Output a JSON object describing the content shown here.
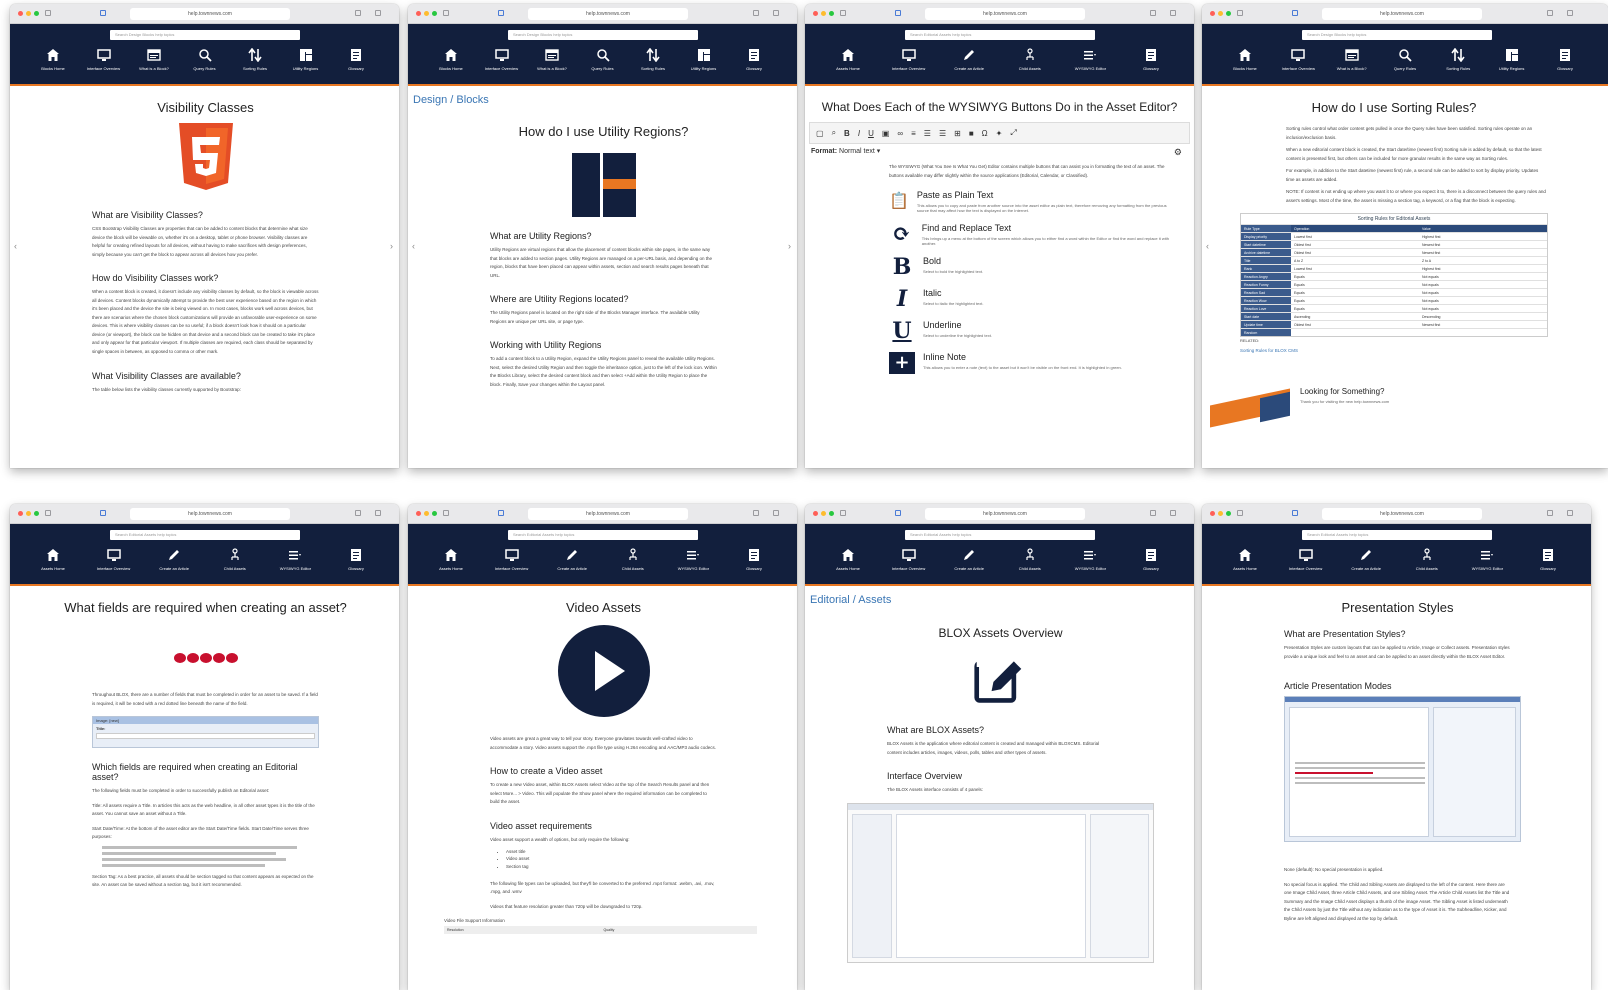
{
  "url": "help.townnews.com",
  "windows": [
    {
      "search": "Search Design Blocks help topics",
      "nav": [
        {
          "icon": "home-icon",
          "label": "Blocks Home"
        },
        {
          "icon": "monitor-icon",
          "label": "Interface Overview"
        },
        {
          "icon": "browser-icon",
          "label": "What is a Block?"
        },
        {
          "icon": "search-icon",
          "label": "Query Rules"
        },
        {
          "icon": "sort-icon",
          "label": "Sorting Rules"
        },
        {
          "icon": "layout-icon",
          "label": "Utility Regions"
        },
        {
          "icon": "book-icon",
          "label": "Glossary"
        }
      ],
      "title": "Visibility Classes",
      "sections": [
        {
          "heading": "What are Visibility Classes?",
          "body": "CSS Bootstrap Visibility Classes are properties that can be added to content blocks that determine what size device the block will be viewable on, whether it's on a desktop, tablet or phone browser. Visibility classes are helpful for creating refined layouts for all devices, without having to make sacrifices with design preferences, simply because you can't get the block to appear across all devices how you prefer."
        },
        {
          "heading": "How do Visibility Classes work?",
          "body": "When a content block is created, it doesn't include any visibility classes by default, so the block is viewable across all devices. Content blocks dynamically attempt to provide the best user experience based on the region in which it's been placed and the device the site is being viewed on. In most cases, blocks work well across devices, but there are scenarios where the chosen block customizations will provide an unfavorable user-experience on some devices. This is where visibility classes can be so useful; if a block doesn't look how it should on a particular device (or viewport), the block can be hidden on that device and a second block can be created to take it's place and only appear for that particular viewport. If multiple classes are required, each class should be separated by single spaces in between, as opposed to comma or other mark."
        },
        {
          "heading": "What Visibility Classes are available?",
          "body": "The table below lists the visibility classes currently supported by Bootstrap:"
        }
      ]
    },
    {
      "search": "Search Design Blocks help topics",
      "nav": [
        {
          "icon": "home-icon",
          "label": "Blocks Home"
        },
        {
          "icon": "monitor-icon",
          "label": "Interface Overview"
        },
        {
          "icon": "browser-icon",
          "label": "What is a Block?"
        },
        {
          "icon": "search-icon",
          "label": "Query Rules"
        },
        {
          "icon": "sort-icon",
          "label": "Sorting Rules"
        },
        {
          "icon": "layout-icon",
          "label": "Utility Regions"
        },
        {
          "icon": "book-icon",
          "label": "Glossary"
        }
      ],
      "breadcrumb": "Design / Blocks",
      "title": "How do I use Utility Regions?",
      "sections": [
        {
          "heading": "What are Utility Regions?",
          "body": "Utility Regions are virtual regions that allow the placement of content blocks within site pages, in the same way that blocks are added to section pages. Utility Regions are managed on a per-URL basis, and depending on the region, blocks that have been placed can appear within assets, section and search results pages beneath that URL."
        },
        {
          "heading": "Where are Utility Regions located?",
          "body": "The Utility Regions panel is located on the right side of the Blocks Manager interface. The available Utility Regions are unique per URL site, or page type."
        },
        {
          "heading": "Working with Utility Regions",
          "body": "To add a content block to a Utility Region, expand the Utility Regions panel to reveal the available Utility Regions. Next, select the desired Utility Region and then toggle the inheritance option, just to the left of the lock icon. Within the Blocks Library, select the desired content block and then select +Add within the Utility Region to place the block. Finally, Save your changes within the Layout panel."
        }
      ]
    },
    {
      "search": "Search Editorial Assets help topics",
      "nav": [
        {
          "icon": "home-icon",
          "label": "Assets Home"
        },
        {
          "icon": "monitor-icon",
          "label": "Interface Overview"
        },
        {
          "icon": "pencil-icon",
          "label": "Create an Article"
        },
        {
          "icon": "tree-icon",
          "label": "Child Assets"
        },
        {
          "icon": "list-icon",
          "label": "WYSIWYG Editor"
        },
        {
          "icon": "book-icon",
          "label": "Glossary"
        }
      ],
      "title": "What Does Each of the WYSIWYG Buttons Do in the Asset Editor?",
      "format_label": "Format:",
      "format_value": "Normal text",
      "intro": "The WYSIWYG (What You See Is What You Get) Editor contains multiple buttons that can assist you in formatting the text of an asset. The buttons available may differ slightly within the source applications (Editorial, Calendar, or Classified).",
      "buttons": [
        {
          "icon": "clipboard-icon",
          "glyph": "📋",
          "name": "Paste as Plain Text",
          "desc": "This allows you to copy and paste from another source into the asset editor as plain text, therefore removing any formatting from the previous source that may affect how the text is displayed on the Internet."
        },
        {
          "icon": "find-replace-icon",
          "glyph": "⟳",
          "name": "Find and Replace Text",
          "desc": "This brings up a menu at the bottom of the screen which allows you to either find a word within the Editor or find the word and replace it with another."
        },
        {
          "icon": "bold-icon",
          "glyph": "B",
          "name": "Bold",
          "desc": "Select to bold the highlighted text."
        },
        {
          "icon": "italic-icon",
          "glyph": "I",
          "name": "Italic",
          "desc": "Select to italic the highlighted text."
        },
        {
          "icon": "underline-icon",
          "glyph": "U",
          "name": "Underline",
          "desc": "Select to underline the highlighted text."
        },
        {
          "icon": "inline-note-icon",
          "glyph": "+",
          "name": "Inline Note",
          "desc": "This allows you to enter a note (text) to the asset but it won't be visible on the front end. It is highlighted in green."
        }
      ]
    },
    {
      "search": "Search Design Blocks help topics",
      "nav": [
        {
          "icon": "home-icon",
          "label": "Blocks Home"
        },
        {
          "icon": "monitor-icon",
          "label": "Interface Overview"
        },
        {
          "icon": "browser-icon",
          "label": "What is a Block?"
        },
        {
          "icon": "search-icon",
          "label": "Query Rules"
        },
        {
          "icon": "sort-icon",
          "label": "Sorting Rules"
        },
        {
          "icon": "layout-icon",
          "label": "Utility Regions"
        },
        {
          "icon": "book-icon",
          "label": "Glossary"
        }
      ],
      "title": "How do I use Sorting Rules?",
      "paragraphs": [
        "Sorting rules control what order content gets pulled in once the Query rules have been satisfied. Sorting rules operate on an inclusion/exclusion basis.",
        "When a new editorial content block is created, the Start date/time (newest first) Sorting rule is added by default, so that the latest content is presented first, but others can be included for more granular results in the same way as Sorting rules.",
        "For example, in addition to the Start datetime (newest first) rule, a second rule can be added to sort by display priority. Updates time as assets are added.",
        "NOTE: If content is not ending up where you want it to or where you expect it to, there is a disconnect between the query rules and asset's settings. Most of the time, the asset is missing a section tag, a keyword, or a flag that the block is expecting."
      ],
      "table": {
        "caption": "Sorting Rules for Editorial Assets",
        "headers": [
          "Rule Type",
          "Operation",
          "Value"
        ],
        "rows": [
          [
            "Display priority",
            "Lowest first",
            "Highest first"
          ],
          [
            "Start datetime",
            "Oldest first",
            "Newest first"
          ],
          [
            "Archive datetime",
            "Oldest first",
            "Newest first"
          ],
          [
            "Title",
            "A to Z",
            "Z to A"
          ],
          [
            "Rank",
            "Lowest first",
            "Highest first"
          ],
          [
            "Reaction Angry",
            "Equals",
            "Not equals"
          ],
          [
            "Reaction Funny",
            "Equals",
            "Not equals"
          ],
          [
            "Reaction Sad",
            "Equals",
            "Not equals"
          ],
          [
            "Reaction Wow",
            "Equals",
            "Not equals"
          ],
          [
            "Reaction Love",
            "Equals",
            "Not equals"
          ],
          [
            "Start date",
            "Ascending",
            "Descending"
          ],
          [
            "Update time",
            "Oldest first",
            "Newest first"
          ],
          [
            "Random",
            "",
            ""
          ]
        ]
      },
      "table_related_label": "RELATED:",
      "table_link": "Sorting Rules for BLOX CMS",
      "footer_heading": "Looking for Something?",
      "footer_text": "Thank you for visiting the new help.townnews.com"
    },
    {
      "search": "Search Editorial Assets help topics",
      "nav": [
        {
          "icon": "home-icon",
          "label": "Assets Home"
        },
        {
          "icon": "monitor-icon",
          "label": "Interface Overview"
        },
        {
          "icon": "pencil-icon",
          "label": "Create an Article"
        },
        {
          "icon": "tree-icon",
          "label": "Child Assets"
        },
        {
          "icon": "list-icon",
          "label": "WYSIWYG Editor"
        },
        {
          "icon": "book-icon",
          "label": "Glossary"
        }
      ],
      "title": "What fields are required when creating an asset?",
      "intro": "Throughout BLOX, there are a number of fields that must be completed in order for an asset to be saved. If a field is required, it will be noted with a red dotted line beneath the name of the field.",
      "field_image_label": "Image: [new]",
      "field_title_label": "Title:",
      "sections": [
        {
          "heading": "Which fields are required when creating an Editorial asset?",
          "body": "The following fields must be completed in order to successfully publish an Editorial asset:"
        },
        {
          "heading": "",
          "body": "Title: All assets require a Title. In articles this acts as the web headline, in all other asset types it is the title of the asset. You cannot save an asset without a Title."
        },
        {
          "heading": "",
          "body": "Start Date/Time: At the bottom of the asset editor are the Start Date/Time fields. Start Date/Time serves three purposes:"
        },
        {
          "heading": "",
          "body": "Section Tag: As a best practice, all assets should be section tagged so that content appears as expected on the site. An asset can be saved without a section tag, but it isn't recommended."
        }
      ]
    },
    {
      "search": "Search Editorial Assets help topics",
      "nav": [
        {
          "icon": "home-icon",
          "label": "Assets Home"
        },
        {
          "icon": "monitor-icon",
          "label": "Interface Overview"
        },
        {
          "icon": "pencil-icon",
          "label": "Create an Article"
        },
        {
          "icon": "tree-icon",
          "label": "Child Assets"
        },
        {
          "icon": "list-icon",
          "label": "WYSIWYG Editor"
        },
        {
          "icon": "book-icon",
          "label": "Glossary"
        }
      ],
      "title": "Video Assets",
      "sections": [
        {
          "heading": "",
          "body": "Video assets are great a great way to tell your story. Everyone gravitates towards well-crafted video to accommodate a story. Video assets support the .mp4 file type using H.264 encoding and AAC/MP3 audio codecs."
        },
        {
          "heading": "How to create a Video asset",
          "body": "To create a new Video asset, within BLOX Assets select Video at the top of the Search Results panel and then select More... > Video. This will populate the Show panel where the required information can be completed to build the asset."
        },
        {
          "heading": "Video asset requirements",
          "body": "Video asset support a wealth of options, but only require the following:"
        }
      ],
      "requirements": [
        "Asset title",
        "Video asset",
        "Section tag"
      ],
      "filetypes_text": "The following file types can be uploaded, but they'll be converted to the preferred .mp4 format: .webm, .avi, .mov, .mpg, and .wmv",
      "resolution_text": "Videos that feature resolution greater than 720p will be downgraded to 720p.",
      "table_caption": "Video File Support Information",
      "table_headers": [
        "Resolution",
        "Quality"
      ]
    },
    {
      "search": "Search Editorial Assets help topics",
      "nav": [
        {
          "icon": "home-icon",
          "label": "Assets Home"
        },
        {
          "icon": "monitor-icon",
          "label": "Interface Overview"
        },
        {
          "icon": "pencil-icon",
          "label": "Create an Article"
        },
        {
          "icon": "tree-icon",
          "label": "Child Assets"
        },
        {
          "icon": "list-icon",
          "label": "WYSIWYG Editor"
        },
        {
          "icon": "book-icon",
          "label": "Glossary"
        }
      ],
      "breadcrumb": "Editorial / Assets",
      "title": "BLOX Assets Overview",
      "sections": [
        {
          "heading": "What are BLOX Assets?",
          "body": "BLOX Assets is the application where editorial content is created and managed within BLOXCMS. Editorial content includes articles, images, videos, polls, tables and other types of assets."
        },
        {
          "heading": "Interface Overview",
          "body": "The BLOX Assets interface consists of 4 panels:"
        }
      ]
    },
    {
      "search": "Search Editorial Assets help topics",
      "nav": [
        {
          "icon": "home-icon",
          "label": "Assets Home"
        },
        {
          "icon": "monitor-icon",
          "label": "Interface Overview"
        },
        {
          "icon": "pencil-icon",
          "label": "Create an Article"
        },
        {
          "icon": "tree-icon",
          "label": "Child Assets"
        },
        {
          "icon": "list-icon",
          "label": "WYSIWYG Editor"
        },
        {
          "icon": "book-icon",
          "label": "Glossary"
        }
      ],
      "title": "Presentation Styles",
      "sections": [
        {
          "heading": "What are Presentation Styles?",
          "body": "Presentation Styles are custom layouts that can be applied to Article, Image or Collect assets. Presentation styles provide a unique look and feel to an asset and can be applied to an asset directly within the BLOX Asset Editor."
        },
        {
          "heading": "Article Presentation Modes",
          "body": ""
        }
      ],
      "mode_text": "None (default): No special presentation is applied.",
      "mode_desc": "No special focus is applied. The Child and Sibling Assets are displayed to the left of the content. Here there are one Image Child Asset, three Article Child Assets, and one Sibling Asset. The Article Child Assets list the Title and Summary and the Image Child Asset displays a thumb of the image Asset. The Sibling Asset is listed underneath the Child Assets by just the Title without any indication as to the type of Asset it is. The Subheadline, Kicker, and Byline are left aligned and displayed at the top by default."
    }
  ],
  "arrows": {
    "prev": "‹",
    "next": "›",
    "prev_label": "PREV",
    "next_label": "NEXT"
  },
  "colors": {
    "header_bg": "#121f3d",
    "accent": "#e87722",
    "link": "#3a76b4",
    "required": "#c8102e"
  }
}
